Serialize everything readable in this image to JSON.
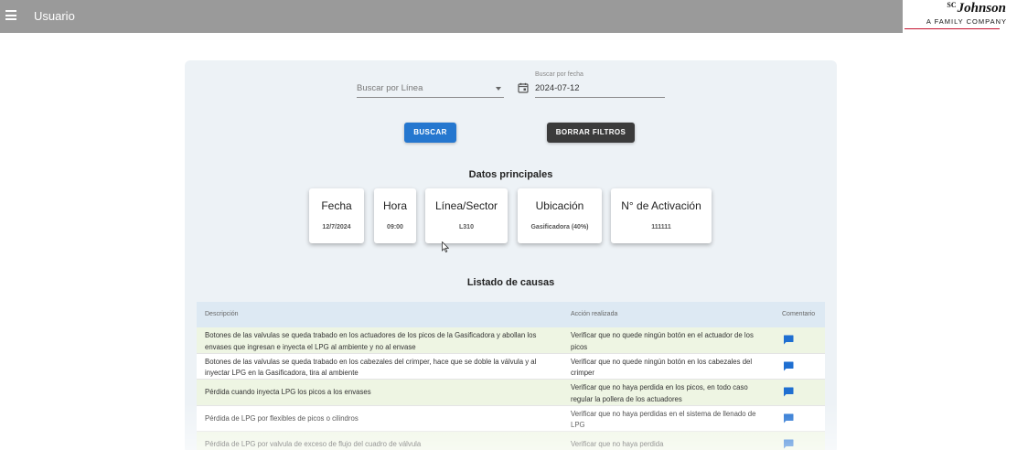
{
  "header": {
    "title": "Usuario",
    "menu_icon": "menu-icon",
    "brand_sc": "SC",
    "brand_name": "Johnson",
    "brand_tagline": "A FAMILY COMPANY",
    "brand_accent": "#c4122f",
    "bar_color": "#9a9a9a"
  },
  "filters": {
    "line_placeholder": "Buscar por Línea",
    "date_label": "Buscar por fecha",
    "date_value": "2024-07-12",
    "date_icon": "calendar-icon",
    "search_label": "BUSCAR",
    "clear_label": "BORRAR FILTROS",
    "search_color": "#2577cf",
    "clear_color": "#3b3b3b"
  },
  "main": {
    "title": "Datos principales",
    "cards": [
      {
        "title": "Fecha",
        "value": "12/7/2024"
      },
      {
        "title": "Hora",
        "value": "09:00"
      },
      {
        "title": "Línea/Sector",
        "value": "L310"
      },
      {
        "title": "Ubicación",
        "value": "Gasificadora (40%)"
      },
      {
        "title": "N° de Activación",
        "value": "111111"
      }
    ]
  },
  "causes": {
    "title": "Listado de causas",
    "headers": {
      "description": "Descripción",
      "action": "Acción realizada",
      "comment": "Comentario"
    },
    "comment_icon": "comment-icon",
    "comment_color": "#1f6fd1",
    "rows": [
      {
        "description": "Botones de las valvulas se queda trabado en los actuadores de los picos de la Gasificadora y abollan los envases que ingresan e inyecta el LPG al ambiente y no al envase",
        "action": "Verificar que no quede ningún botón en el actuador de los picos"
      },
      {
        "description": "Botones de las valvulas se queda trabado en los cabezales del crimper, hace que se doble la válvula y al inyectar LPG en la Gasificadora, tira al ambiente",
        "action": "Verificar que no quede ningún botón en los cabezales del crimper"
      },
      {
        "description": "Pérdida cuando inyecta LPG los picos a los envases",
        "action": "Verificar que no haya perdida en los picos, en todo caso regular la pollera de los actuadores"
      },
      {
        "description": "Pérdida de LPG por flexibles de picos o cilindros",
        "action": "Verificar que no haya perdidas en el sistema de llenado de LPG"
      },
      {
        "description": "Pérdida de LPG por valvula de exceso de flujo del cuadro de válvula",
        "action": "Verificar que no haya perdida"
      }
    ]
  }
}
